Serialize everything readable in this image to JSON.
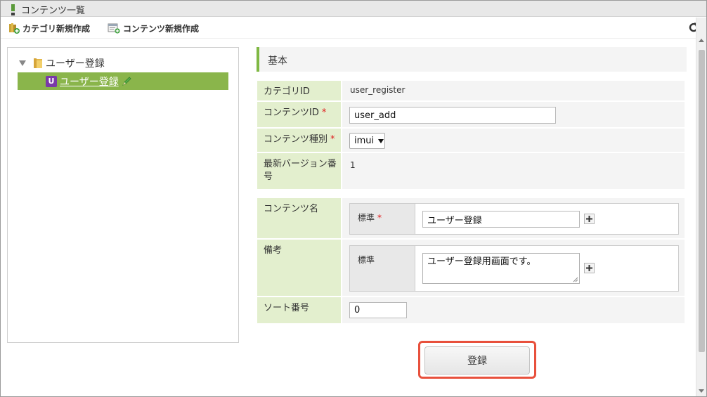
{
  "window": {
    "title": "コンテンツ一覧"
  },
  "toolbar": {
    "new_category_label": "カテゴリ新規作成",
    "new_content_label": "コンテンツ新規作成"
  },
  "tree": {
    "root_label": "ユーザー登録",
    "child_badge": "U",
    "child_label": "ユーザー登録"
  },
  "form": {
    "section_title": "基本",
    "category_id": {
      "label": "カテゴリID",
      "value": "user_register"
    },
    "content_id": {
      "label": "コンテンツID",
      "required_mark": "*",
      "value": "user_add"
    },
    "content_type": {
      "label": "コンテンツ種別",
      "required_mark": "*",
      "selected": "imui"
    },
    "latest_version": {
      "label": "最新バージョン番号",
      "value": "1"
    },
    "content_name": {
      "label": "コンテンツ名",
      "lang_label": "標準",
      "required_mark": "*",
      "value": "ユーザー登録"
    },
    "remarks": {
      "label": "備考",
      "lang_label": "標準",
      "value": "ユーザー登録用画面です。"
    },
    "sort_number": {
      "label": "ソート番号",
      "value": "0"
    },
    "submit_label": "登録"
  },
  "colors": {
    "accent_green": "#8ab54b",
    "label_bg": "#e3efce",
    "highlight_red": "#e8503c"
  }
}
